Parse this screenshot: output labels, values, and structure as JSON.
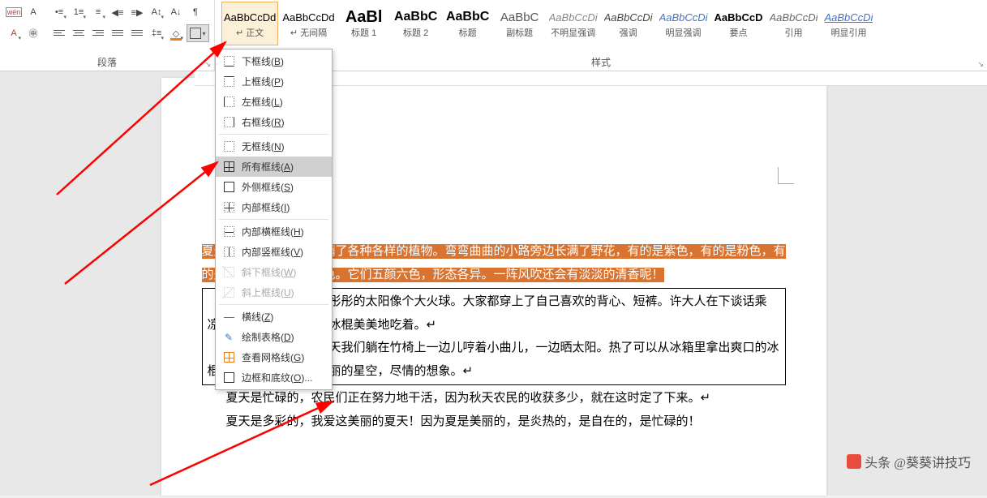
{
  "ribbon": {
    "paragraph_label": "段落",
    "styles_label": "样式"
  },
  "styles": [
    {
      "preview": "AaBbCcDd",
      "name": "↵ 正文",
      "selected": true,
      "css": ""
    },
    {
      "preview": "AaBbCcDd",
      "name": "↵ 无间隔",
      "css": ""
    },
    {
      "preview": "AaBl",
      "name": "标题 1",
      "css": "font-size:20px;font-weight:bold;color:#000"
    },
    {
      "preview": "AaBbC",
      "name": "标题 2",
      "css": "font-size:16px;font-weight:bold"
    },
    {
      "preview": "AaBbC",
      "name": "标题",
      "css": "font-size:16px;font-weight:bold"
    },
    {
      "preview": "AaBbC",
      "name": "副标题",
      "css": "font-size:15px;color:#555"
    },
    {
      "preview": "AaBbCcDi",
      "name": "不明显强调",
      "css": "font-style:italic;color:#888"
    },
    {
      "preview": "AaBbCcDi",
      "name": "强调",
      "css": "font-style:italic;color:#444"
    },
    {
      "preview": "AaBbCcDi",
      "name": "明显强调",
      "css": "font-style:italic;color:#4472c4"
    },
    {
      "preview": "AaBbCcD",
      "name": "要点",
      "css": "font-weight:bold"
    },
    {
      "preview": "AaBbCcDi",
      "name": "引用",
      "css": "font-style:italic;color:#666"
    },
    {
      "preview": "AaBbCcDi",
      "name": "明显引用",
      "css": "font-style:italic;color:#4472c4;text-decoration:underline"
    }
  ],
  "border_menu": [
    {
      "label": "下框线",
      "key": "B",
      "icon": "bottom"
    },
    {
      "label": "上框线",
      "key": "P",
      "icon": "top"
    },
    {
      "label": "左框线",
      "key": "L",
      "icon": "left"
    },
    {
      "label": "右框线",
      "key": "R",
      "icon": "right"
    },
    {
      "sep": true
    },
    {
      "label": "无框线",
      "key": "N",
      "icon": "none"
    },
    {
      "label": "所有框线",
      "key": "A",
      "icon": "all",
      "hover": true
    },
    {
      "label": "外侧框线",
      "key": "S",
      "icon": "outside"
    },
    {
      "label": "内部框线",
      "key": "I",
      "icon": "inside"
    },
    {
      "sep": true
    },
    {
      "label": "内部横框线",
      "key": "H",
      "icon": "h"
    },
    {
      "label": "内部竖框线",
      "key": "V",
      "icon": "v"
    },
    {
      "label": "斜下框线",
      "key": "W",
      "icon": "diag-down",
      "disabled": true
    },
    {
      "label": "斜上框线",
      "key": "U",
      "icon": "diag-up",
      "disabled": true
    },
    {
      "sep": true
    },
    {
      "label": "横线",
      "key": "Z",
      "icon": "hline"
    },
    {
      "label": "绘制表格",
      "key": "D",
      "icon": "draw"
    },
    {
      "label": "查看网格线",
      "key": "G",
      "icon": "grid"
    },
    {
      "label": "边框和底纹",
      "key": "O",
      "icon": "dialog",
      "ellipsis": true
    }
  ],
  "document": {
    "p1": "夏天是美丽的。墙上爬满了各种各样的植物。弯弯曲曲的小路旁边长满了野花，有的是紫色，有的是粉色，有的是蓝色，还有的是黄色。它们五颜六色，形态各异。一阵风吹还会有淡淡的清香呢！",
    "p2": "夏天是炎热的。红彤彤的太阳像个大火球。大家都穿上了自己喜欢的背心、短裤。许大人在下谈话乘凉，一旁的小朋友拿着冰棍美美地吃着。↵",
    "p3": "夏天是自在的。白天我们躺在竹椅上一边儿哼着小曲儿，一边晒太阳。热了可以从冰箱里拿出爽口的冰棍吃。夜晚我们看着美丽的星空，尽情的想象。↵",
    "p4": "夏天是忙碌的，农民们正在努力地干活，因为秋天农民的收获多少，就在这时定了下来。↵",
    "p5": "夏天是多彩的，我爱这美丽的夏天！因为夏是美丽的，是炎热的，是自在的，是忙碌的！"
  },
  "watermark": "头条 @葵葵讲技巧"
}
